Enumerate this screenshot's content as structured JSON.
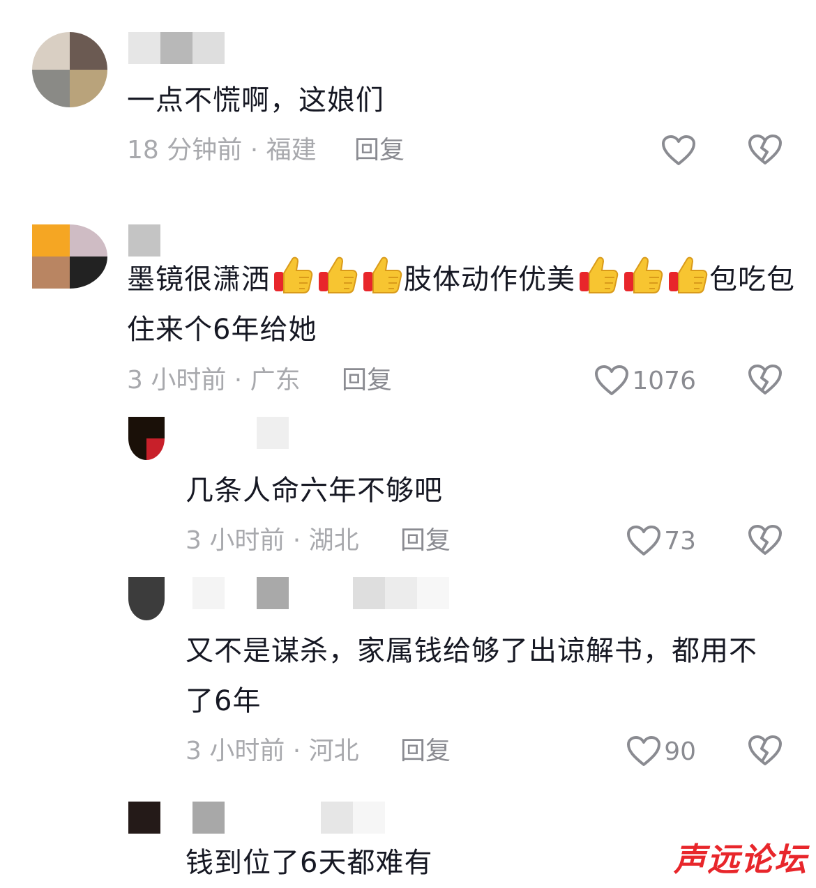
{
  "colors": {
    "text": "#161823",
    "meta": "#a8a9ad",
    "action": "#8a8b91",
    "watermark": "#e8262b"
  },
  "icons": {
    "like": "heart-outline-icon",
    "dislike": "broken-heart-icon",
    "thumbs_up": "thumbs-up-emoji"
  },
  "comments": [
    {
      "text": "一点不慌啊，这娘们",
      "time_location": "18 分钟前 · 福建",
      "reply_label": "回复",
      "likes": ""
    },
    {
      "text_part1": "墨镜很潇洒",
      "text_part2": "肢体动作优美",
      "text_part3": "包吃包住来个6年给她",
      "time_location": "3 小时前 · 广东",
      "reply_label": "回复",
      "likes": "1076"
    },
    {
      "text": "几条人命六年不够吧",
      "time_location": "3 小时前 · 湖北",
      "reply_label": "回复",
      "likes": "73"
    },
    {
      "text": "又不是谋杀，家属钱给够了出谅解书，都用不了6年",
      "time_location": "3 小时前 · 河北",
      "reply_label": "回复",
      "likes": "90"
    },
    {
      "text": "钱到位了6天都难有",
      "time_location": "",
      "reply_label": "",
      "likes": ""
    }
  ],
  "watermark": "声远论坛"
}
